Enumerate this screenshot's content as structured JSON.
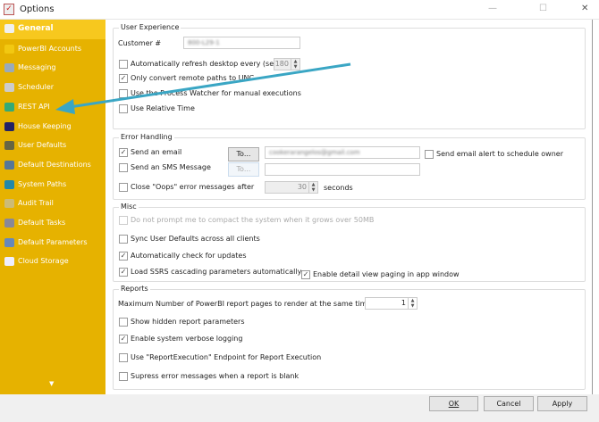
{
  "window": {
    "title": "Options",
    "minimize": "—",
    "maximize": "☐",
    "close": "✕"
  },
  "sidebar": {
    "items": [
      {
        "label": "General",
        "icon": "general-icon",
        "color": "#f0f0f0"
      },
      {
        "label": "PowerBI Accounts",
        "icon": "powerbi-icon",
        "color": "#f2c811"
      },
      {
        "label": "Messaging",
        "icon": "messaging-icon",
        "color": "#9ab"
      },
      {
        "label": "Scheduler",
        "icon": "clock-icon",
        "color": "#ccc"
      },
      {
        "label": "REST API",
        "icon": "globe-icon",
        "color": "#3a7"
      },
      {
        "label": "House Keeping",
        "icon": "housekeeping-icon",
        "color": "#226"
      },
      {
        "label": "User Defaults",
        "icon": "users-icon",
        "color": "#664"
      },
      {
        "label": "Default Destinations",
        "icon": "destinations-icon",
        "color": "#579"
      },
      {
        "label": "System Paths",
        "icon": "globe-icon",
        "color": "#28a"
      },
      {
        "label": "Audit Trail",
        "icon": "audit-icon",
        "color": "#cb7"
      },
      {
        "label": "Default Tasks",
        "icon": "tasks-icon",
        "color": "#889"
      },
      {
        "label": "Default Parameters",
        "icon": "parameters-icon",
        "color": "#68b"
      },
      {
        "label": "Cloud Storage",
        "icon": "cloud-icon",
        "color": "#eef"
      }
    ],
    "scroll_down": "▼"
  },
  "user_experience": {
    "title": "User Experience",
    "customer_label": "Customer #",
    "customer_value": "800-L29-1",
    "auto_refresh": {
      "label": "Automatically refresh desktop every (secs)",
      "checked": false,
      "value": "180"
    },
    "unc": {
      "label": "Only convert remote paths to UNC",
      "checked": true
    },
    "process_watcher": {
      "label": "Use the Process Watcher for manual executions",
      "checked": false
    },
    "relative_time": {
      "label": "Use Relative Time",
      "checked": false
    }
  },
  "error_handling": {
    "title": "Error Handling",
    "send_email": {
      "label": "Send an email",
      "checked": true,
      "to": "To...",
      "value": "cookerarangelos@gmail.com"
    },
    "send_alert_owner": {
      "label": "Send email alert to schedule owner",
      "checked": false
    },
    "send_sms": {
      "label": "Send an SMS Message",
      "checked": false,
      "to": "To...",
      "value": ""
    },
    "close_oops": {
      "label": "Close \"Oops\" error messages after",
      "checked": false,
      "value": "30",
      "unit": "seconds"
    }
  },
  "misc": {
    "title": "Misc",
    "compact": {
      "label": "Do not prompt me to compact the system when it grows over 50MB",
      "checked": false
    },
    "sync_defaults": {
      "label": "Sync User Defaults across all clients",
      "checked": false
    },
    "check_updates": {
      "label": "Automatically check for updates",
      "checked": true
    },
    "ssrs": {
      "label": "Load SSRS cascading parameters automatically",
      "checked": true
    },
    "paging": {
      "label": "Enable detail view paging in app window",
      "checked": true
    }
  },
  "reports": {
    "title": "Reports",
    "max_pages": {
      "label": "Maximum Number  of PowerBI report pages to render at the same time",
      "value": "1"
    },
    "hidden_params": {
      "label": "Show hidden report parameters",
      "checked": false
    },
    "verbose": {
      "label": "Enable system verbose logging",
      "checked": true
    },
    "report_execution": {
      "label": "Use \"ReportExecution\" Endpoint for Report Execution",
      "checked": false
    },
    "suppress_blank": {
      "label": "Supress error messages when a report is blank",
      "checked": false
    }
  },
  "footer": {
    "ok": "OK",
    "cancel": "Cancel",
    "apply": "Apply"
  },
  "annotation": {
    "arrow_color": "#3aa6c4"
  },
  "check_glyph": "✓"
}
